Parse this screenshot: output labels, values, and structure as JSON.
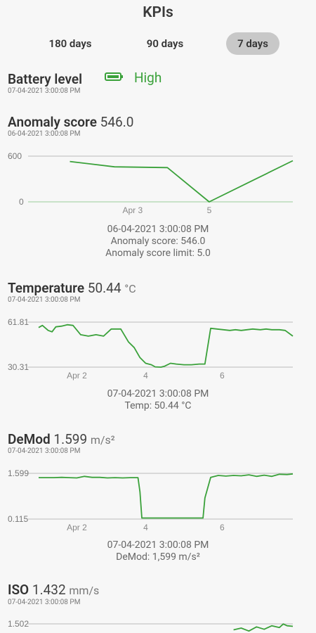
{
  "title": "KPIs",
  "tabs": [
    {
      "label": "180 days",
      "active": false
    },
    {
      "label": "90 days",
      "active": false
    },
    {
      "label": "7 days",
      "active": true
    }
  ],
  "battery": {
    "label": "Battery level",
    "value": "High",
    "timestamp": "07-04-2021 3:00:08 PM",
    "color": "#3aa13a",
    "icon": "battery-icon"
  },
  "anomaly": {
    "label": "Anomaly score",
    "value": "546.0",
    "timestamp": "06-04-2021 3:00:08 PM",
    "info_line1": "06-04-2021 3:00:08 PM",
    "info_line2": "Anomaly score: 546.0",
    "info_line3": "Anomaly score limit: 5.0"
  },
  "temperature": {
    "label": "Temperature",
    "value": "50.44",
    "unit": "°C",
    "timestamp": "07-04-2021 3:00:08 PM",
    "info_line1": "07-04-2021 3:00:08 PM",
    "info_line2": "Temp: 50.44 °C"
  },
  "demod": {
    "label": "DeMod",
    "value": "1.599",
    "unit": "m/s²",
    "timestamp": "07-04-2021 3:00:08 PM",
    "info_line1": "07-04-2021 3:00:08 PM",
    "info_line2": "DeMod: 1,599 m/s²"
  },
  "iso": {
    "label": "ISO",
    "value": "1.432",
    "unit": "mm/s",
    "timestamp": "07-04-2021 3:00:08 PM"
  },
  "colors": {
    "line": "#3aa13a",
    "grid": "#cfcfcf",
    "active_tab": "#c8c8c8"
  },
  "chart_data": [
    {
      "type": "line",
      "name": "anomaly",
      "ylim": [
        0,
        600
      ],
      "y_ticks": [
        "600",
        "0"
      ],
      "x_ticks": [
        "Apr 3",
        "5"
      ],
      "x": [
        0,
        0.32,
        0.7,
        1.0,
        1.6
      ],
      "y": [
        530,
        460,
        450,
        0,
        540
      ],
      "x_tick_pos": [
        0.45,
        1.0
      ],
      "xrange": [
        -0.3,
        1.6
      ]
    },
    {
      "type": "line",
      "name": "temperature",
      "ylim": [
        30.31,
        61.81
      ],
      "y_ticks": [
        "61.81",
        "30.31"
      ],
      "x_ticks": [
        "Apr 2",
        "4",
        "6"
      ],
      "x_tick_pos": [
        1.2,
        3.0,
        5.0
      ],
      "xrange": [
        0.2,
        6.85
      ],
      "x": [
        0.2,
        0.3,
        0.45,
        0.55,
        0.65,
        0.8,
        0.95,
        1.1,
        1.3,
        1.5,
        1.7,
        1.9,
        2.1,
        2.2,
        2.35,
        2.55,
        2.7,
        2.85,
        3.0,
        3.15,
        3.25,
        3.4,
        3.5,
        3.65,
        3.8,
        4.0,
        4.2,
        4.4,
        4.55,
        4.7,
        5.2,
        5.35,
        5.5,
        5.65,
        5.8,
        6.0,
        6.15,
        6.3,
        6.5,
        6.65,
        6.85
      ],
      "y": [
        58,
        59.5,
        56,
        55,
        58.5,
        59,
        60,
        59.5,
        53,
        52,
        53,
        52,
        57,
        57,
        57,
        48,
        44,
        37,
        33,
        32,
        30.5,
        30.3,
        31,
        33,
        32.5,
        32,
        32,
        32.5,
        32.5,
        57.5,
        56,
        56.5,
        56,
        56.5,
        57,
        56.5,
        57,
        56.5,
        56.5,
        56,
        52
      ]
    },
    {
      "type": "line",
      "name": "demod",
      "ylim": [
        0.115,
        1.599
      ],
      "y_ticks": [
        "1.599",
        "0.115"
      ],
      "x_ticks": [
        "Apr 2",
        "4",
        "6"
      ],
      "x_tick_pos": [
        1.2,
        3.0,
        5.0
      ],
      "xrange": [
        0.2,
        6.85
      ],
      "x": [
        0.2,
        0.4,
        0.6,
        0.8,
        1.0,
        1.2,
        1.4,
        1.6,
        1.8,
        2.0,
        2.2,
        2.4,
        2.6,
        2.8,
        2.85,
        2.9,
        3.5,
        4.0,
        4.4,
        4.5,
        4.55,
        4.7,
        4.9,
        5.1,
        5.3,
        5.5,
        5.7,
        5.9,
        6.1,
        6.3,
        6.5,
        6.7,
        6.85
      ],
      "y": [
        1.46,
        1.46,
        1.46,
        1.47,
        1.46,
        1.45,
        1.5,
        1.47,
        1.47,
        1.45,
        1.46,
        1.45,
        1.46,
        1.46,
        1.0,
        0.15,
        0.15,
        0.15,
        0.15,
        0.15,
        0.8,
        1.47,
        1.53,
        1.51,
        1.53,
        1.52,
        1.55,
        1.5,
        1.54,
        1.5,
        1.57,
        1.56,
        1.58
      ]
    },
    {
      "type": "line",
      "name": "iso",
      "ylim": [
        0,
        1.502
      ],
      "y_ticks": [
        "1.502"
      ],
      "x_ticks": [],
      "x_tick_pos": [],
      "xrange": [
        0.2,
        6.85
      ],
      "x": [
        5.3,
        5.5,
        5.7,
        5.9,
        6.1,
        6.3,
        6.5,
        6.6,
        6.7,
        6.85
      ],
      "y": [
        1.4,
        1.43,
        1.38,
        1.45,
        1.41,
        1.47,
        1.44,
        1.5,
        1.47,
        1.46
      ]
    }
  ]
}
